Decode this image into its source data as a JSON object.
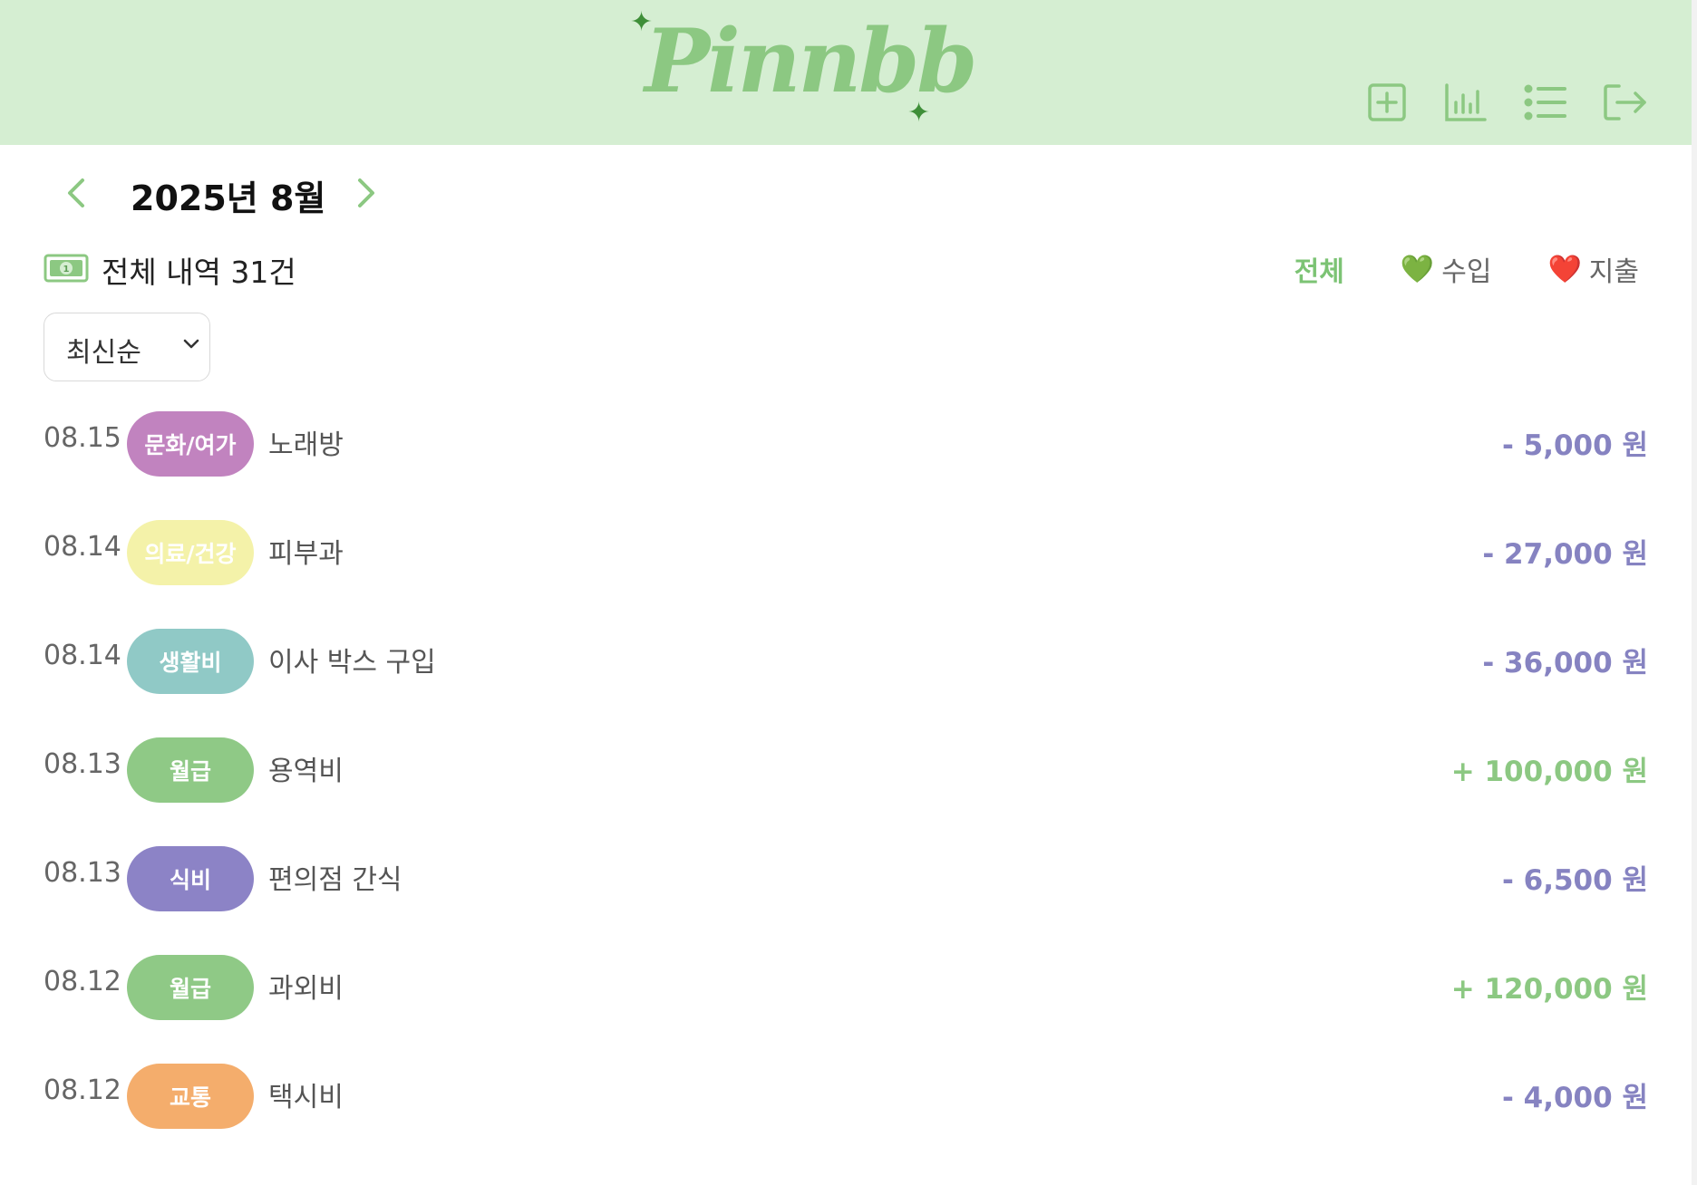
{
  "header": {
    "logo_text": "Pinnbb",
    "icons": [
      "add-icon",
      "chart-icon",
      "list-icon",
      "logout-icon"
    ],
    "background": "#d5eed2",
    "accent": "#8cc882"
  },
  "month_nav": {
    "title": "2025년 8월",
    "prev_icon": "chevron-left-icon",
    "next_icon": "chevron-right-icon"
  },
  "summary": {
    "label": "전체 내역 31건",
    "icon": "money-icon"
  },
  "filters": {
    "all": "전체",
    "income_emoji": "💚",
    "income": "수입",
    "expense_emoji": "❤️",
    "expense": "지출"
  },
  "sort": {
    "selected": "최신순"
  },
  "transactions": [
    {
      "date": "08.15",
      "category": "문화/여가",
      "memo": "노래방",
      "amount": "- 5,000 원",
      "badge_color": "#c183bf",
      "amount_color": "#8683c1"
    },
    {
      "date": "08.14",
      "category": "의료/건강",
      "memo": "피부과",
      "amount": "- 27,000 원",
      "badge_color": "#f4f2a9",
      "amount_color": "#8683c1"
    },
    {
      "date": "08.14",
      "category": "생활비",
      "memo": "이사 박스 구입",
      "amount": "- 36,000 원",
      "badge_color": "#90c9c6",
      "amount_color": "#8683c1"
    },
    {
      "date": "08.13",
      "category": "월급",
      "memo": "용역비",
      "amount": "+ 100,000 원",
      "badge_color": "#8fc986",
      "amount_color": "#8cc882"
    },
    {
      "date": "08.13",
      "category": "식비",
      "memo": "편의점 간식",
      "amount": "- 6,500 원",
      "badge_color": "#8c83c6",
      "amount_color": "#8683c1"
    },
    {
      "date": "08.12",
      "category": "월급",
      "memo": "과외비",
      "amount": "+ 120,000 원",
      "badge_color": "#8fc986",
      "amount_color": "#8cc882"
    },
    {
      "date": "08.12",
      "category": "교통",
      "memo": "택시비",
      "amount": "- 4,000 원",
      "badge_color": "#f4ad6c",
      "amount_color": "#8683c1"
    }
  ]
}
